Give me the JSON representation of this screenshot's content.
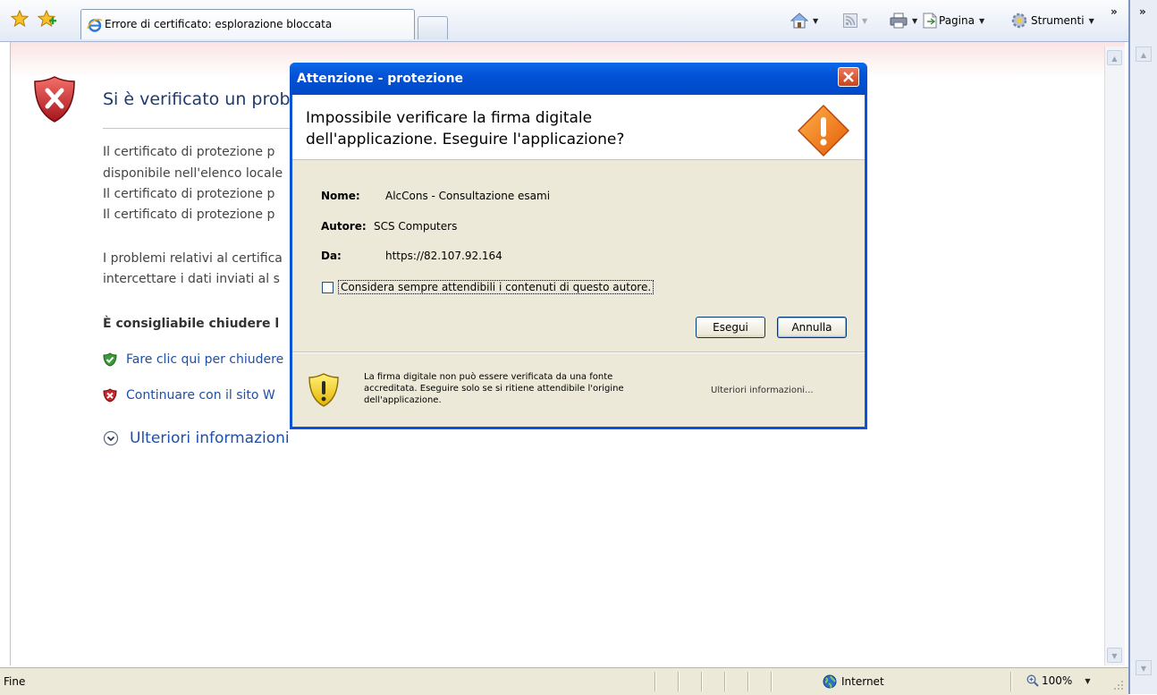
{
  "toolbar": {
    "tab_title": "Errore di certificato: esplorazione bloccata",
    "page_label": "Pagina",
    "tools_label": "Strumenti",
    "chevron": "»"
  },
  "page": {
    "title": "Si è verificato un prob",
    "paragraphs": [
      "Il certificato di protezione p",
      "disponibile nell'elenco locale",
      "Il certificato di protezione p",
      "Il certificato di protezione p",
      "I problemi relativi al certifica",
      "intercettare i dati inviati al s"
    ],
    "recommend": "È consigliabile chiudere l",
    "close_link": "Fare clic qui per chiudere",
    "continue_link": "Continuare con il sito W",
    "more_info": "Ulteriori informazioni"
  },
  "dialog": {
    "title": "Attenzione - protezione",
    "heading_line1": "Impossibile verificare la firma digitale",
    "heading_line2": "dell'applicazione.  Eseguire l'applicazione?",
    "fields": [
      {
        "label": "Nome:",
        "value": "AlcCons - Consultazione esami"
      },
      {
        "label": "Autore:",
        "value": "SCS Computers"
      },
      {
        "label": "Da:",
        "value": "https://82.107.92.164"
      }
    ],
    "checkbox_label": "Considera sempre attendibili i contenuti di questo autore.",
    "checkbox_checked": false,
    "run_button": "Esegui",
    "cancel_button": "Annulla",
    "footer_text": "La firma digitale non può essere verificata da una fonte accreditata.  Eseguire solo se si ritiene attendibile l'origine dell'applicazione.",
    "footer_link": "Ulteriori informazioni..."
  },
  "status": {
    "left": "Fine",
    "zone": "Internet",
    "zoom": "100%"
  },
  "colors": {
    "dialog_frame": "#0a53d8",
    "dialog_body": "#ece9d8",
    "link": "#1f4fa6",
    "title_blue": "#1f3a6b"
  }
}
